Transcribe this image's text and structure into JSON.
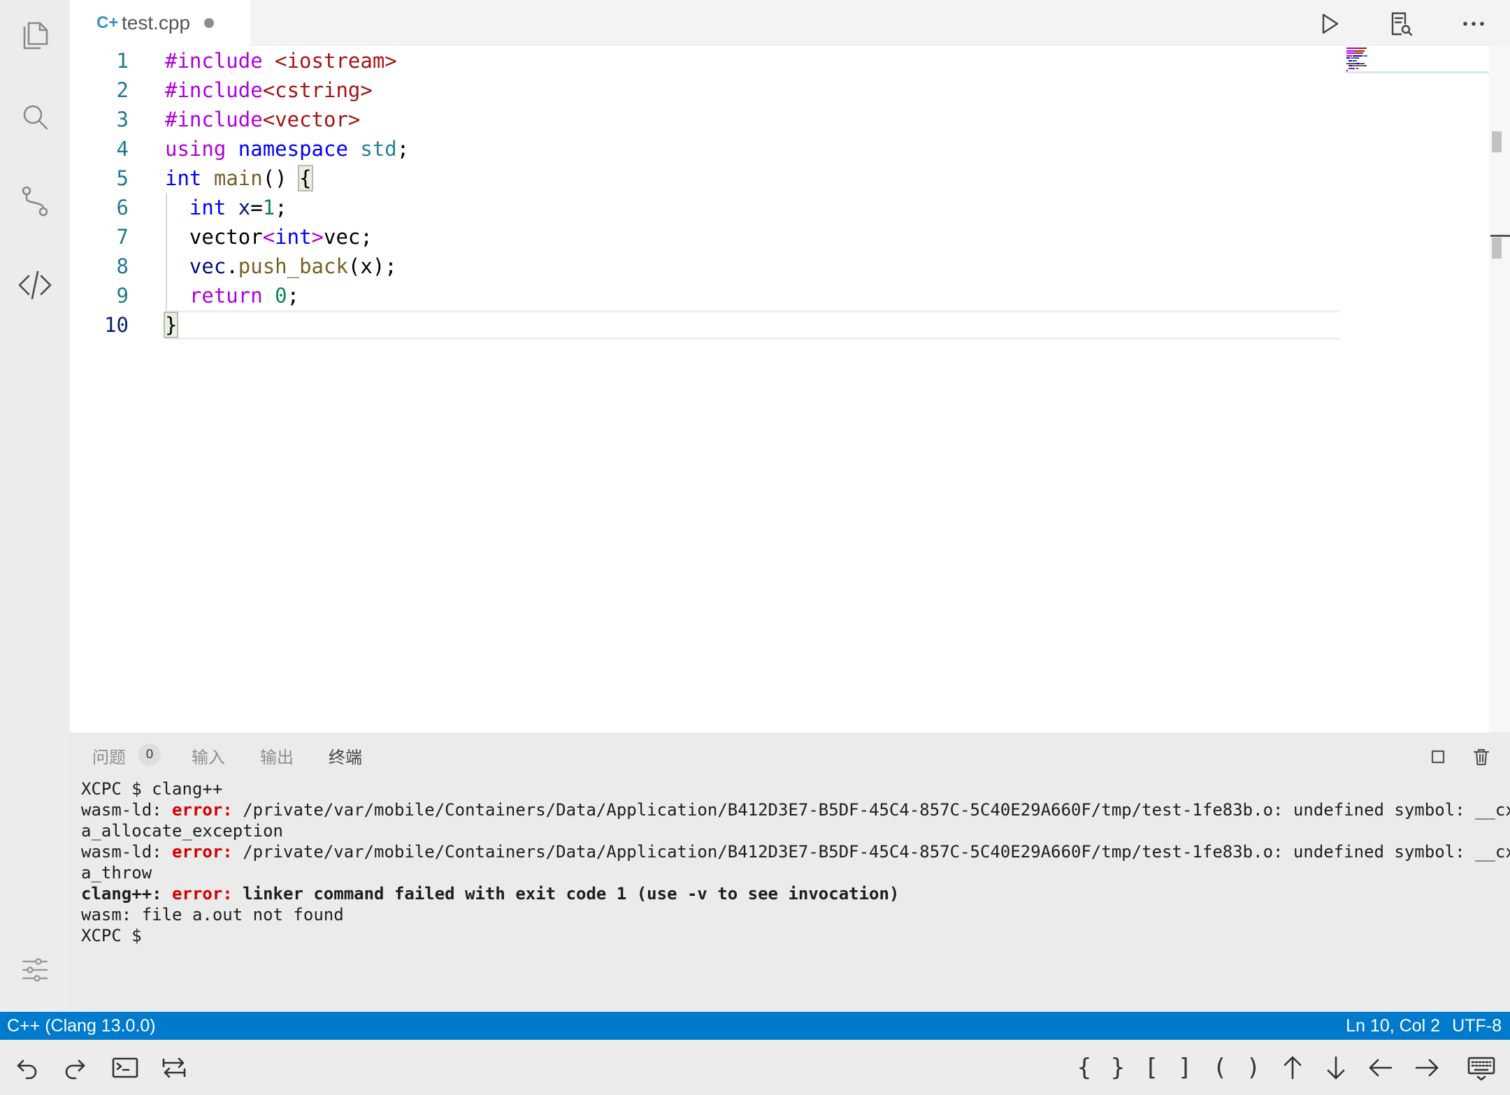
{
  "tabs": [
    {
      "label": "test.cpp",
      "icon": "cpp-file-icon",
      "icon_text": "C+",
      "dirty": true
    }
  ],
  "editor": {
    "current_line": 10,
    "lines": [
      {
        "no": "1",
        "tokens": [
          {
            "t": "#include ",
            "c": "pp"
          },
          {
            "t": "<iostream>",
            "c": "str"
          }
        ]
      },
      {
        "no": "2",
        "tokens": [
          {
            "t": "#include",
            "c": "pp"
          },
          {
            "t": "<cstring>",
            "c": "str"
          }
        ]
      },
      {
        "no": "3",
        "tokens": [
          {
            "t": "#include",
            "c": "pp"
          },
          {
            "t": "<vector>",
            "c": "str"
          }
        ]
      },
      {
        "no": "4",
        "tokens": [
          {
            "t": "using",
            "c": "ctl"
          },
          {
            "t": " "
          },
          {
            "t": "namespace",
            "c": "kw"
          },
          {
            "t": " "
          },
          {
            "t": "std",
            "c": "type"
          },
          {
            "t": ";"
          }
        ]
      },
      {
        "no": "5",
        "tokens": [
          {
            "t": "int",
            "c": "kw"
          },
          {
            "t": " "
          },
          {
            "t": "main",
            "c": "fn"
          },
          {
            "t": "() "
          },
          {
            "t": "{",
            "c": "match"
          }
        ]
      },
      {
        "no": "6",
        "tokens": [
          {
            "t": "  "
          },
          {
            "t": "int",
            "c": "kw"
          },
          {
            "t": " "
          },
          {
            "t": "x",
            "c": "var"
          },
          {
            "t": "="
          },
          {
            "t": "1",
            "c": "num"
          },
          {
            "t": ";"
          }
        ]
      },
      {
        "no": "7",
        "tokens": [
          {
            "t": "  vector"
          },
          {
            "t": "<",
            "c": "ctl"
          },
          {
            "t": "int",
            "c": "kw"
          },
          {
            "t": ">",
            "c": "ctl"
          },
          {
            "t": "vec;"
          }
        ]
      },
      {
        "no": "8",
        "tokens": [
          {
            "t": "  "
          },
          {
            "t": "vec",
            "c": "var"
          },
          {
            "t": "."
          },
          {
            "t": "push_back",
            "c": "fn"
          },
          {
            "t": "(x);"
          }
        ]
      },
      {
        "no": "9",
        "tokens": [
          {
            "t": "  "
          },
          {
            "t": "return",
            "c": "ctl"
          },
          {
            "t": " "
          },
          {
            "t": "0",
            "c": "num"
          },
          {
            "t": ";"
          }
        ]
      },
      {
        "no": "10",
        "tokens": [
          {
            "t": "}",
            "c": "match"
          }
        ]
      }
    ]
  },
  "panel": {
    "tabs": [
      {
        "label": "问题",
        "badge": "0"
      },
      {
        "label": "输入"
      },
      {
        "label": "输出"
      },
      {
        "label": "终端",
        "active": true
      }
    ],
    "terminal_lines": [
      [
        {
          "t": "XCPC $ clang++"
        }
      ],
      [
        {
          "t": "wasm-ld: "
        },
        {
          "t": "error:",
          "c": "err"
        },
        {
          "t": " /private/var/mobile/Containers/Data/Application/B412D3E7-B5DF-45C4-857C-5C40E29A660F/tmp/test-1fe83b.o: undefined symbol: __cx"
        }
      ],
      [
        {
          "t": "a_allocate_exception"
        }
      ],
      [
        {
          "t": "wasm-ld: "
        },
        {
          "t": "error:",
          "c": "err"
        },
        {
          "t": " /private/var/mobile/Containers/Data/Application/B412D3E7-B5DF-45C4-857C-5C40E29A660F/tmp/test-1fe83b.o: undefined symbol: __cx"
        }
      ],
      [
        {
          "t": "a_throw"
        }
      ],
      [
        {
          "t": "clang++: ",
          "c": "bold"
        },
        {
          "t": "error:",
          "c": "err"
        },
        {
          "t": " linker command failed with exit code 1 (use -v to see invocation)",
          "c": "bold"
        }
      ],
      [
        {
          "t": "wasm: file a.out not found"
        }
      ],
      [
        {
          "t": "XCPC $"
        }
      ]
    ]
  },
  "status": {
    "language": "C++ (Clang 13.0.0)",
    "position": "Ln 10, Col 2",
    "encoding": "UTF-8"
  },
  "keys": {
    "brace_open": "{",
    "brace_close": "}",
    "bracket_open": "[",
    "bracket_close": "]",
    "paren_open": "(",
    "paren_close": ")"
  },
  "colors": {
    "status_bar": "#007acc",
    "keyword": "#0000ff",
    "preprocessor": "#af00db",
    "string": "#a31515",
    "error": "#d20000"
  }
}
